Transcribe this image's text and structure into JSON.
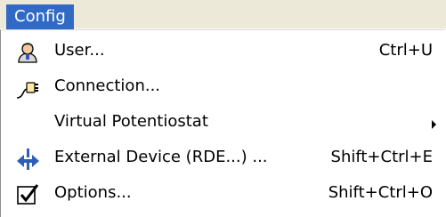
{
  "menubar": {
    "active_menu": "Config"
  },
  "menu": {
    "items": [
      {
        "label": "User...",
        "shortcut": "Ctrl+U",
        "icon": "user-icon"
      },
      {
        "label": "Connection...",
        "shortcut": "",
        "icon": "connection-plug-icon"
      },
      {
        "label": "Virtual Potentiostat",
        "shortcut": "",
        "icon": "",
        "submenu": true
      },
      {
        "label": "External Device (RDE...) ...",
        "shortcut": "Shift+Ctrl+E",
        "icon": "external-device-icon"
      },
      {
        "label": "Options...",
        "shortcut": "Shift+Ctrl+O",
        "icon": "options-checkbox-icon"
      }
    ]
  },
  "colors": {
    "menubar_bg": "#ece9d8",
    "highlight": "#316ac5",
    "menu_bg": "#ffffff"
  }
}
